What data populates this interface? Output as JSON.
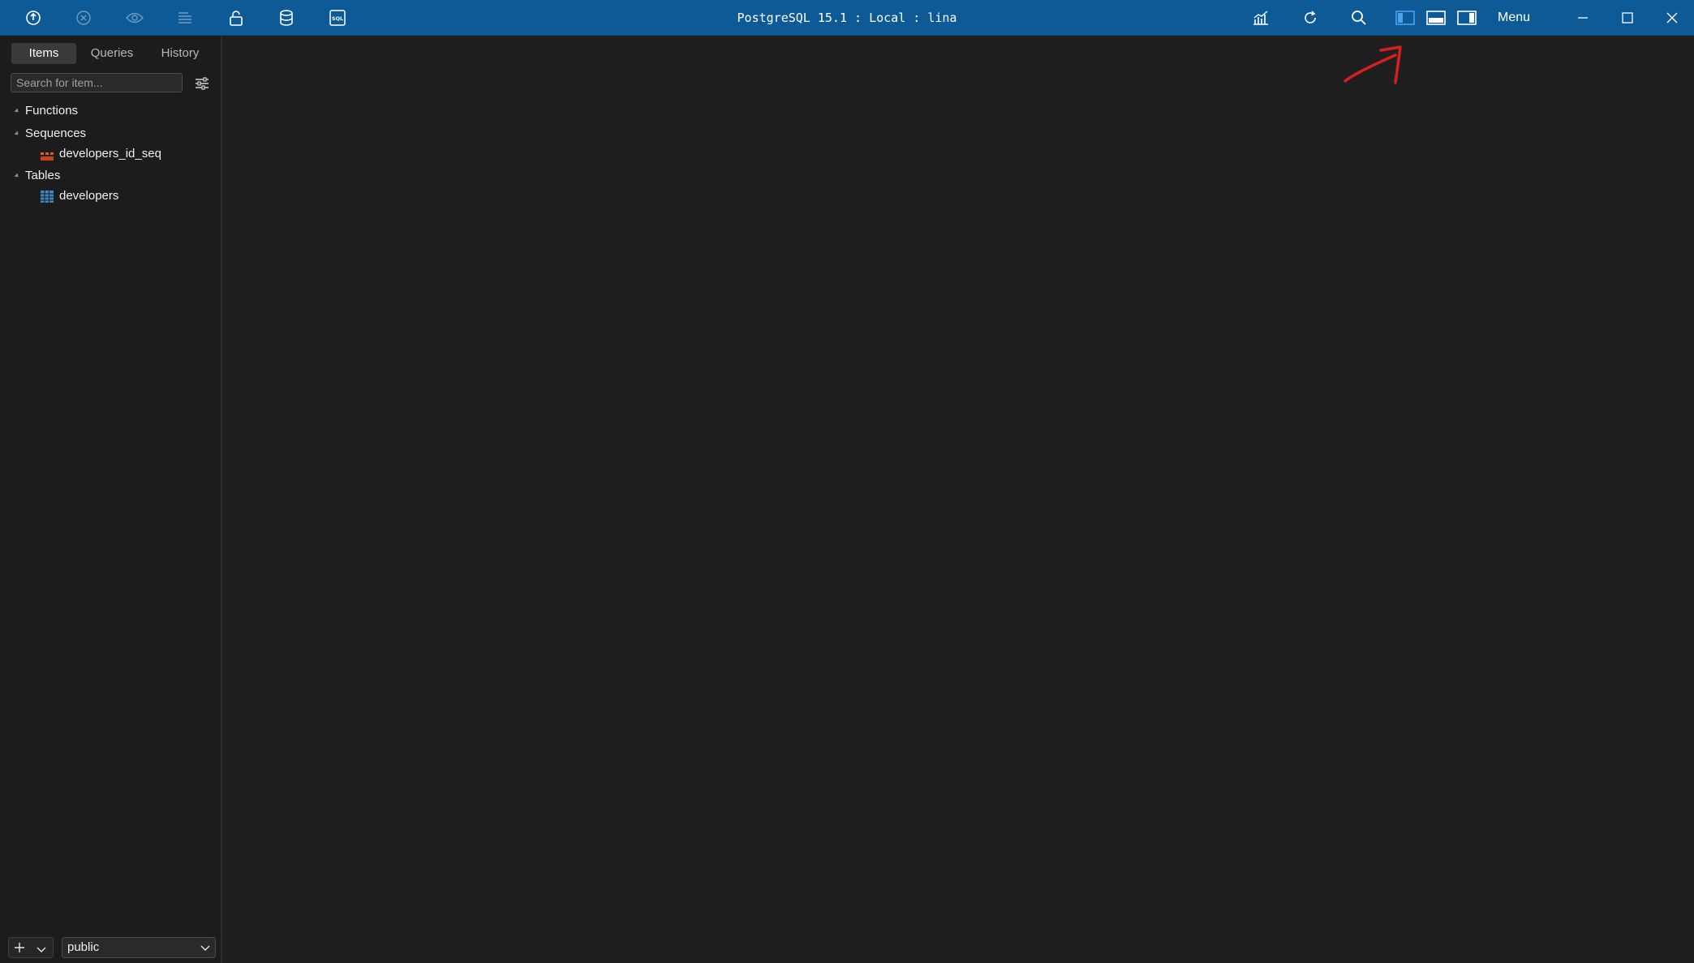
{
  "window": {
    "title": "PostgreSQL 15.1 : Local : lina",
    "menu_label": "Menu"
  },
  "toolbar": {
    "left_icons": [
      "connection-icon",
      "close-connection-icon",
      "preview-icon",
      "format-icon",
      "lock-icon",
      "database-icon",
      "sql-query-icon"
    ],
    "right_icons": [
      "activity-monitor-icon",
      "refresh-icon",
      "search-icon",
      "toggle-left-panel-icon",
      "toggle-bottom-panel-icon",
      "toggle-right-panel-icon"
    ],
    "window_controls": [
      "minimize-icon",
      "maximize-icon",
      "close-icon"
    ],
    "accent": "#0e5a96",
    "highlight": "#4aa3f0"
  },
  "sidebar": {
    "tabs": [
      {
        "label": "Items",
        "active": true
      },
      {
        "label": "Queries",
        "active": false
      },
      {
        "label": "History",
        "active": false
      }
    ],
    "search": {
      "placeholder": "Search for item...",
      "value": ""
    },
    "tree": [
      {
        "label": "Functions",
        "level": 0
      },
      {
        "label": "Sequences",
        "level": 0
      },
      {
        "label": "developers_id_seq",
        "level": 1,
        "icon": "sequence-icon"
      },
      {
        "label": "Tables",
        "level": 0
      },
      {
        "label": "developers",
        "level": 1,
        "icon": "table-icon"
      }
    ],
    "schema_select": {
      "value": "public"
    }
  },
  "colors": {
    "annotation_arrow": "#d62020"
  }
}
